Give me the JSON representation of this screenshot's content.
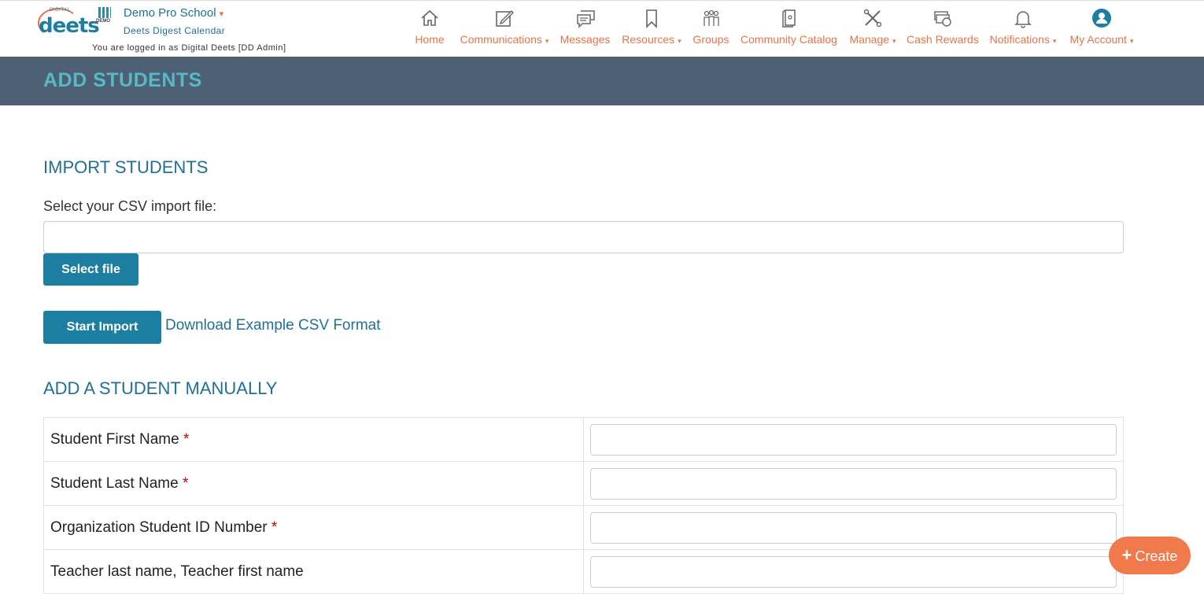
{
  "app": {
    "logo_small": "DIGITAL",
    "logo_text": "deets",
    "school_logo_tag": "DEMO",
    "school_name": "Demo Pro School",
    "school_caret": "▾",
    "school_subtitle": "Deets Digest Calendar",
    "logged_in_text": "You are logged in as Digital Deets [DD Admin]"
  },
  "nav": {
    "items": [
      {
        "label": "Home",
        "icon": "home-icon"
      },
      {
        "label": "Communications",
        "icon": "edit-icon",
        "caret": "▾"
      },
      {
        "label": "Messages",
        "icon": "messages-icon"
      },
      {
        "label": "Resources",
        "icon": "bookmark-icon",
        "caret": "▾"
      },
      {
        "label": "Groups",
        "icon": "groups-icon"
      },
      {
        "label": "Community Catalog",
        "icon": "catalog-icon"
      },
      {
        "label": "Manage",
        "icon": "tools-icon",
        "caret": "▾"
      },
      {
        "label": "Cash Rewards",
        "icon": "cash-icon"
      },
      {
        "label": "Notifications",
        "icon": "bell-icon",
        "caret": "▾"
      },
      {
        "label": "My Account",
        "icon": "user-icon",
        "caret": "▾"
      }
    ]
  },
  "page": {
    "title": "ADD STUDENTS"
  },
  "import": {
    "title": "IMPORT STUDENTS",
    "csv_label": "Select your CSV import file:",
    "file_value": "",
    "select_file_label": "Select file",
    "start_import_label": "Start Import",
    "download_link": "Download Example CSV Format"
  },
  "manual": {
    "title": "ADD A STUDENT MANUALLY",
    "required_mark": "*",
    "fields": [
      {
        "label": "Student First Name",
        "required": true,
        "value": ""
      },
      {
        "label": "Student Last Name",
        "required": true,
        "value": ""
      },
      {
        "label": "Organization Student ID Number",
        "required": true,
        "value": ""
      },
      {
        "label": "Teacher last name, Teacher first name",
        "required": false,
        "value": ""
      }
    ]
  },
  "fab": {
    "icon": "plus-icon",
    "plus": "+",
    "label": "Create"
  },
  "colors": {
    "accent": "#e8734a",
    "primary": "#1c7fa1",
    "banner": "#4e6174",
    "banner_title": "#58b8c7",
    "fab": "#f07a4c"
  }
}
